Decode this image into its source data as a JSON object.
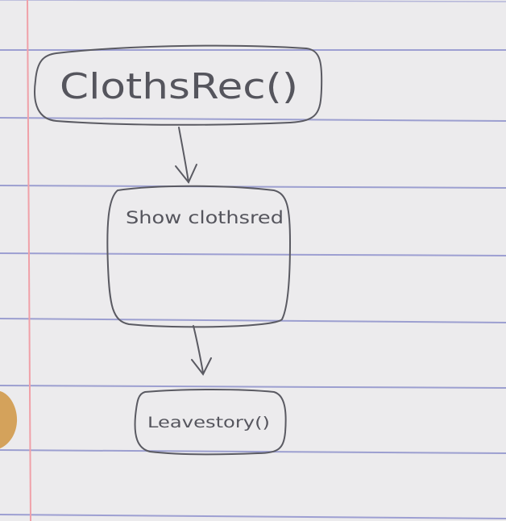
{
  "diagram": {
    "nodes": [
      {
        "id": "clothes-rec",
        "label": "ClothsRec()"
      },
      {
        "id": "show-clothes",
        "label": "Show clothsred"
      },
      {
        "id": "leave-store",
        "label": "Leavestory()"
      }
    ],
    "edges": [
      {
        "from": "clothes-rec",
        "to": "show-clothes"
      },
      {
        "from": "show-clothes",
        "to": "leave-store"
      }
    ]
  },
  "colors": {
    "paper": "#ecebed",
    "ruled_line": "#8f92cc",
    "margin_line": "#f0a0a8",
    "pencil": "#55555d",
    "stain": "#d29a4a"
  }
}
